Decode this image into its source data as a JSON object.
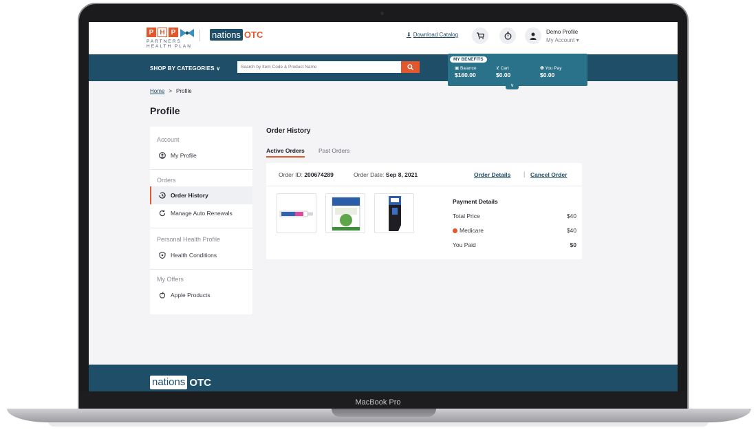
{
  "device": {
    "label": "MacBook Pro"
  },
  "header": {
    "partner_letters": [
      "P",
      "H",
      "P"
    ],
    "partner_text": "PARTNERS HEALTH PLAN",
    "brand_nations": "nations",
    "brand_otc": "OTC",
    "download_label": "Download Catalog",
    "icons": [
      "cart-icon",
      "timer-icon",
      "user-icon"
    ],
    "profile_name": "Demo Profile",
    "profile_account": "My Account ▾"
  },
  "navbar": {
    "shop_label": "SHOP BY CATEGORIES ∨",
    "search_placeholder": "Search by Item Code & Product Name"
  },
  "benefits": {
    "title": "MY BENEFITS",
    "balance_label": "Balance",
    "balance_value": "$160.00",
    "cart_label": "Cart",
    "cart_value": "$0.00",
    "you_pay_label": "You Pay",
    "you_pay_value": "$0.00",
    "chevron": "∨"
  },
  "breadcrumb": {
    "home": "Home",
    "separator": ">",
    "current": "Profile"
  },
  "page_title": "Profile",
  "sidebar": {
    "sections": [
      {
        "heading": "Account",
        "items": [
          {
            "label": "My Profile",
            "icon": "user-circle-icon"
          }
        ]
      },
      {
        "heading": "Orders",
        "items": [
          {
            "label": "Order History",
            "icon": "history-icon"
          },
          {
            "label": "Manage Auto Renewals",
            "icon": "renew-icon"
          }
        ]
      },
      {
        "heading": "Personal Health Profile",
        "items": [
          {
            "label": "Health Conditions",
            "icon": "shield-icon"
          }
        ]
      },
      {
        "heading": "My Offers",
        "items": [
          {
            "label": "Apple Products",
            "icon": "apple-icon"
          }
        ]
      }
    ]
  },
  "main": {
    "title": "Order History",
    "tabs": [
      "Active Orders",
      "Past Orders"
    ],
    "order": {
      "id_label": "Order ID:",
      "id_value": "200674289",
      "date_label": "Order Date:",
      "date_value": "Sep 8, 2021",
      "details_link": "Order Details",
      "separator": "|",
      "cancel_link": "Cancel Order",
      "products": [
        "toothpaste-tube",
        "mucinex-box",
        "black-stocking"
      ],
      "payment": {
        "title": "Payment Details",
        "rows": [
          {
            "label": "Total Price",
            "value": "$40"
          },
          {
            "label": "Medicare",
            "value": "$40"
          },
          {
            "label": "You Paid",
            "value": "$0"
          }
        ]
      }
    }
  },
  "footer": {
    "brand_nations": "nations",
    "brand_otc": "OTC"
  },
  "colors": {
    "primary": "#1f4e68",
    "accent": "#e2572c",
    "benefits": "#2a7289"
  }
}
